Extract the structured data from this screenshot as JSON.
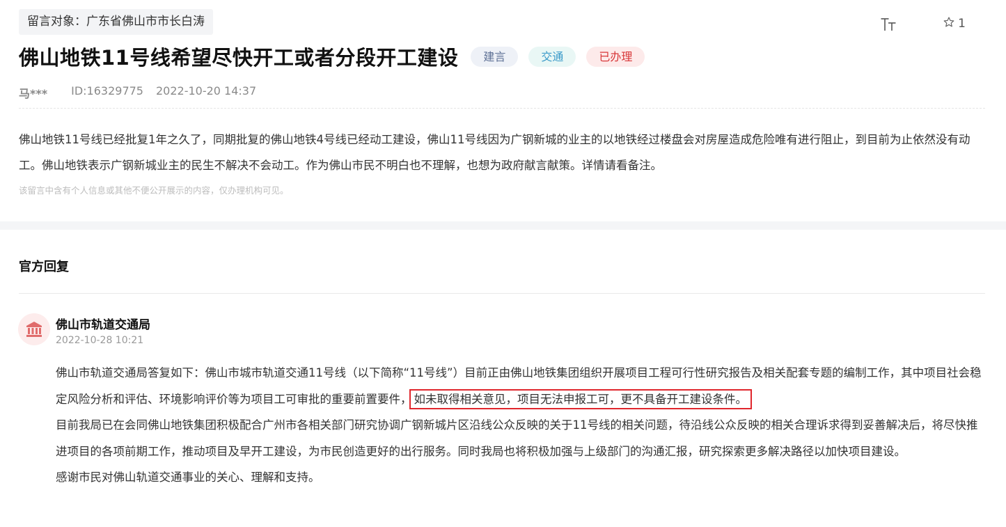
{
  "message": {
    "target_label": "留言对象：广东省佛山市市长白涛",
    "title": "佛山地铁11号线希望尽快开工或者分段开工建设",
    "tags": [
      {
        "label": "建言",
        "bg": "#eef1f7",
        "color": "#5c6f94"
      },
      {
        "label": "交通",
        "bg": "#e9f7f5",
        "color": "#3a9ac9"
      },
      {
        "label": "已办理",
        "bg": "#fdeaea",
        "color": "#d8383a"
      }
    ],
    "author": "马***",
    "id": "ID:16329775",
    "datetime": "2022-10-20 14:37",
    "content": "佛山地铁11号线已经批复1年之久了，同期批复的佛山地铁4号线已经动工建设，佛山11号线因为广钢新城的业主的以地铁经过楼盘会对房屋造成危险唯有进行阻止，到目前为止依然没有动工。佛山地铁表示广钢新城业主的民生不解决不会动工。作为佛山市民不明白也不理解，也想为政府献言献策。详情请看备注。",
    "privacy_notice": "该留言中含有个人信息或其他不便公开展示的内容，仅办理机构可见。"
  },
  "toolbar": {
    "font_size_icon": "text-size-icon",
    "favorite_icon": "star-outline-icon",
    "favorite_count": "1"
  },
  "reply": {
    "section_title": "官方回复",
    "department": "佛山市轨道交通局",
    "department_icon": "government-building-icon",
    "date": "2022-10-28 10:21",
    "para1_before": "佛山市轨道交通局答复如下：佛山市城市轨道交通11号线（以下简称“11号线”）目前正由佛山地铁集团组织开展项目工程可行性研究报告及相关配套专题的编制工作，其中项目社会稳定风险分析和评估、环境影响评价等为项目工可审批的重要前置要件，",
    "para1_highlight": "如未取得相关意见，项目无法申报工可，更不具备开工建设条件。",
    "para2": "目前我局已在会同佛山地铁集团积极配合广州市各相关部门研究协调广钢新城片区沿线公众反映的关于11号线的相关问题，待沿线公众反映的相关合理诉求得到妥善解决后，将尽快推进项目的各项前期工作，推动项目及早开工建设，为市民创造更好的出行服务。同时我局也将积极加强与上级部门的沟通汇报，研究探索更多解决路径以加快项目建设。",
    "para3": "感谢市民对佛山轨道交通事业的关心、理解和支持。",
    "highlight_color": "#e0262c"
  }
}
